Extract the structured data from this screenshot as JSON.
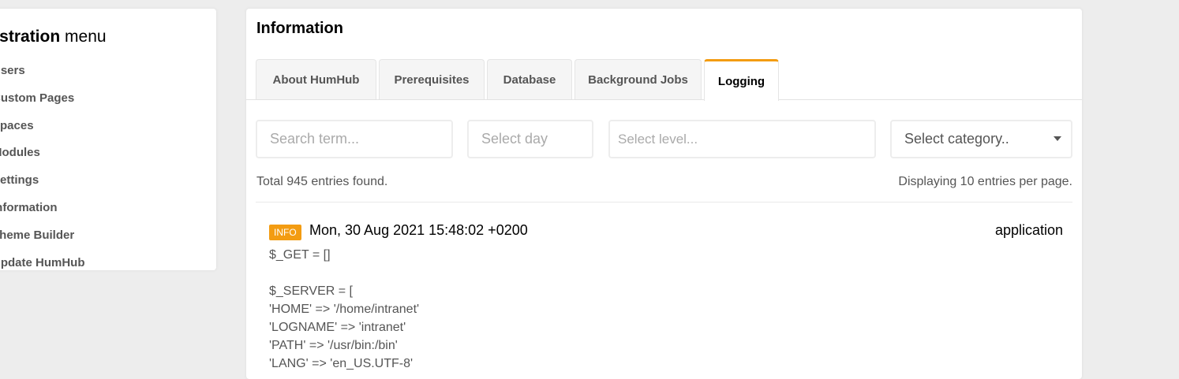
{
  "sidebar": {
    "title_bold": "ministration",
    "title_light": "menu",
    "items": [
      {
        "label": "Users"
      },
      {
        "label": "Custom Pages"
      },
      {
        "label": "Spaces"
      },
      {
        "label": "Modules"
      },
      {
        "label": "Settings"
      },
      {
        "label": "Information"
      },
      {
        "label": "Theme Builder"
      },
      {
        "label": "Update HumHub"
      }
    ]
  },
  "panel": {
    "title": "Information",
    "tabs": [
      {
        "label": "About HumHub"
      },
      {
        "label": "Prerequisites"
      },
      {
        "label": "Database"
      },
      {
        "label": "Background Jobs"
      },
      {
        "label": "Logging",
        "active": true
      }
    ]
  },
  "filters": {
    "search_placeholder": "Search term...",
    "day_placeholder": "Select day",
    "level_placeholder": "Select level...",
    "category_value": "Select category.."
  },
  "summary": {
    "total": "Total 945 entries found.",
    "per_page": "Displaying 10 entries per page."
  },
  "log_entry": {
    "level": "INFO",
    "date": "Mon, 30 Aug 2021 15:48:02 +0200",
    "category": "application",
    "lines": [
      "$_GET = []",
      "",
      "$_SERVER = [",
      "'HOME' => '/home/intranet'",
      "'LOGNAME' => 'intranet'",
      "'PATH' => '/usr/bin:/bin'",
      "'LANG' => 'en_US.UTF-8'"
    ]
  },
  "colors": {
    "accent": "#f39c12",
    "background": "#ededed"
  }
}
